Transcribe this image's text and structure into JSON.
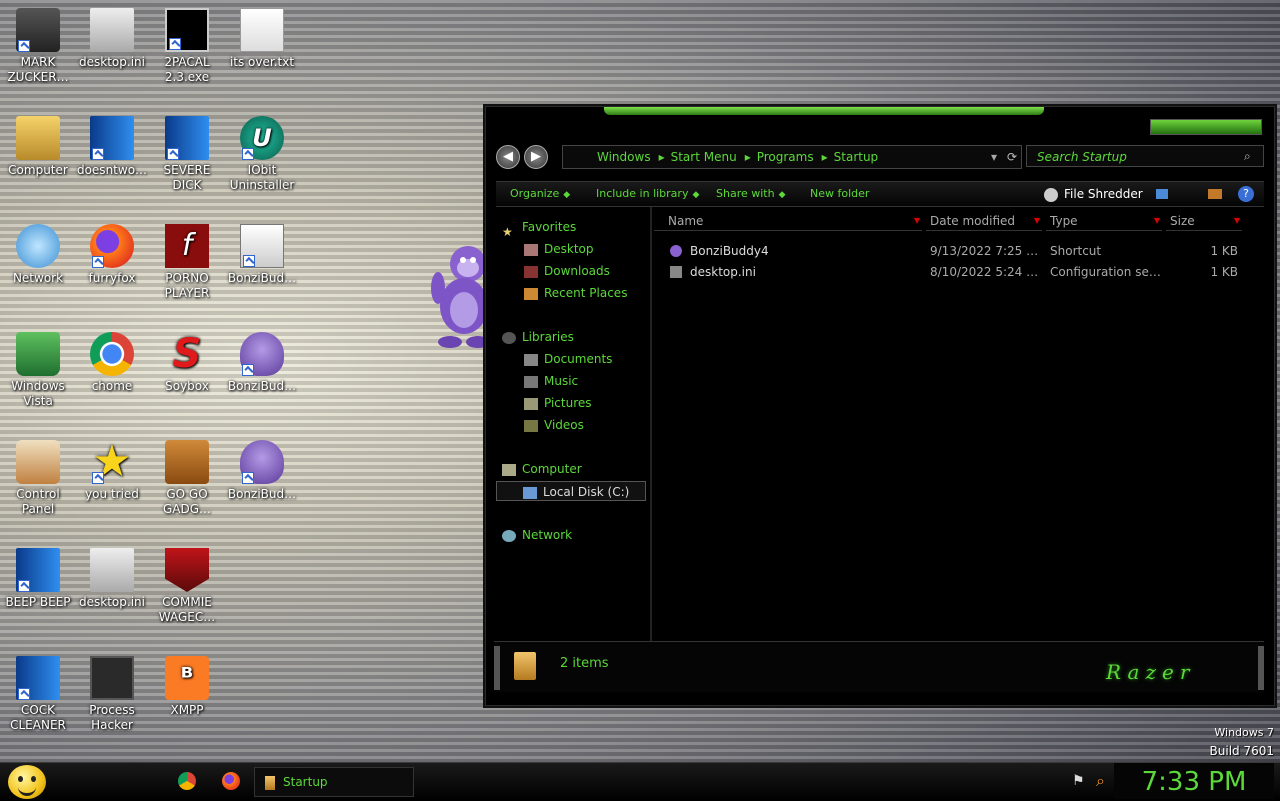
{
  "desktop": {
    "icons": [
      {
        "label": "MARK ZUCKER…"
      },
      {
        "label": "desktop.ini"
      },
      {
        "label": "2PACAL 2.3.exe"
      },
      {
        "label": "its over.txt"
      },
      {
        "label": "Computer"
      },
      {
        "label": "doesntwo…"
      },
      {
        "label": "SEVERE DICK"
      },
      {
        "label": "IObit Uninstaller"
      },
      {
        "label": "Network"
      },
      {
        "label": "furryfox"
      },
      {
        "label": "PORNO PLAYER"
      },
      {
        "label": "BonziBud…"
      },
      {
        "label": "Windows Vista"
      },
      {
        "label": "chome"
      },
      {
        "label": "Soybox"
      },
      {
        "label": "BonziBud…"
      },
      {
        "label": "Control Panel"
      },
      {
        "label": "you tried"
      },
      {
        "label": "GO GO GADG…"
      },
      {
        "label": "BonziBud…"
      },
      {
        "label": "BEEP BEEP"
      },
      {
        "label": "desktop.ini"
      },
      {
        "label": "COMMIE WAGEC…"
      },
      {
        "label": "COCK CLEANER"
      },
      {
        "label": "Process Hacker"
      },
      {
        "label": "XMPP"
      }
    ]
  },
  "explorer": {
    "breadcrumb": [
      "Windows",
      "Start Menu",
      "Programs",
      "Startup"
    ],
    "search_placeholder": "Search Startup",
    "toolbar": {
      "organize": "Organize",
      "include_in_library": "Include in library",
      "share_with": "Share with",
      "new_folder": "New folder",
      "file_shredder": "File Shredder"
    },
    "nav": {
      "favorites": "Favorites",
      "desktop": "Desktop",
      "downloads": "Downloads",
      "recent_places": "Recent Places",
      "libraries": "Libraries",
      "documents": "Documents",
      "music": "Music",
      "pictures": "Pictures",
      "videos": "Videos",
      "computer": "Computer",
      "local_disk": "Local Disk (C:)",
      "network": "Network"
    },
    "columns": {
      "name": "Name",
      "date": "Date modified",
      "type": "Type",
      "size": "Size"
    },
    "files": [
      {
        "name": "BonziBuddy4",
        "date": "9/13/2022 7:25 …",
        "type": "Shortcut",
        "size": "1 KB"
      },
      {
        "name": "desktop.ini",
        "date": "8/10/2022 5:24 …",
        "type": "Configuration se…",
        "size": "1 KB"
      }
    ],
    "status": {
      "count": "2 items",
      "brand": "Razer"
    }
  },
  "watermark": {
    "line1": "Windows 7",
    "line2": "Build 7601"
  },
  "taskbar": {
    "task_label": "Startup",
    "clock": "7:33 PM"
  },
  "colors": {
    "accent": "#5cd83b",
    "window_bg": "#000000"
  }
}
